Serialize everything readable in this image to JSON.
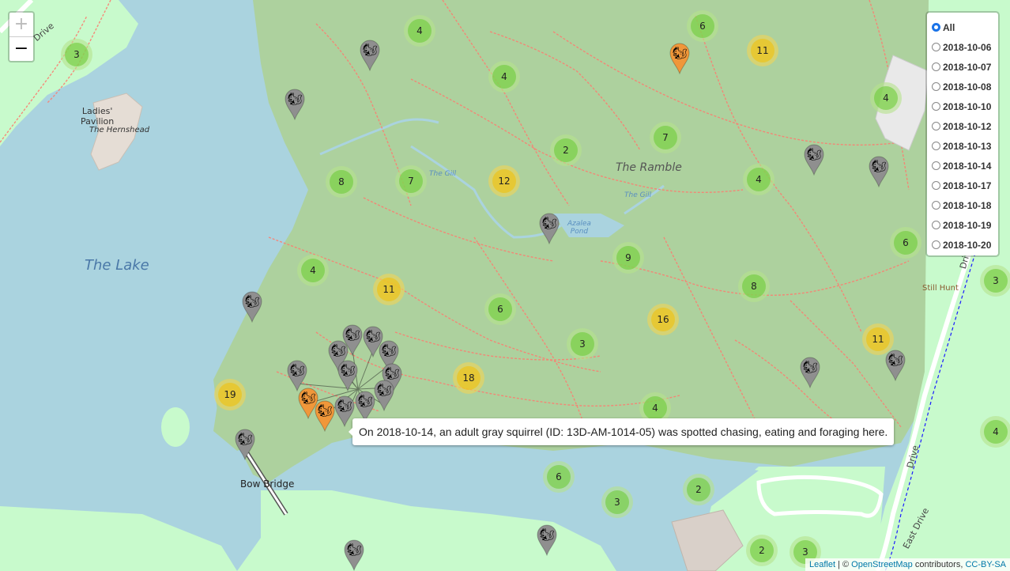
{
  "map": {
    "labels": {
      "ramble": "The Ramble",
      "lake": "The Lake",
      "ladies_pavilion": "Ladies'\nPavilion",
      "hernshead": "The Hernshead",
      "gill1": "The Gill",
      "gill2": "The Gill",
      "azalea_pond": "Azalea\nPond",
      "still_hunt": "Still Hunt",
      "bow_bridge": "Bow Bridge",
      "east_drive1": "East Drive",
      "east_drive2": "Drive",
      "drive_tl": "Drive",
      "drive_r": "Drive"
    },
    "clusters": [
      {
        "count": "3",
        "size": "small"
      },
      {
        "count": "4",
        "size": "small"
      },
      {
        "count": "6",
        "size": "small"
      },
      {
        "count": "11",
        "size": "medium"
      },
      {
        "count": "4",
        "size": "small"
      },
      {
        "count": "4",
        "size": "small"
      },
      {
        "count": "2",
        "size": "small"
      },
      {
        "count": "7",
        "size": "small"
      },
      {
        "count": "8",
        "size": "small"
      },
      {
        "count": "7",
        "size": "small"
      },
      {
        "count": "12",
        "size": "medium"
      },
      {
        "count": "4",
        "size": "small"
      },
      {
        "count": "6",
        "size": "small"
      },
      {
        "count": "9",
        "size": "small"
      },
      {
        "count": "8",
        "size": "small"
      },
      {
        "count": "4",
        "size": "small"
      },
      {
        "count": "11",
        "size": "medium"
      },
      {
        "count": "6",
        "size": "small"
      },
      {
        "count": "16",
        "size": "medium"
      },
      {
        "count": "3",
        "size": "small"
      },
      {
        "count": "11",
        "size": "medium"
      },
      {
        "count": "19",
        "size": "medium"
      },
      {
        "count": "18",
        "size": "medium"
      },
      {
        "count": "4",
        "size": "small"
      },
      {
        "count": "6",
        "size": "small"
      },
      {
        "count": "3",
        "size": "small"
      },
      {
        "count": "2",
        "size": "small"
      },
      {
        "count": "2",
        "size": "small"
      },
      {
        "count": "3",
        "size": "small"
      },
      {
        "count": "3",
        "size": "small"
      },
      {
        "count": "4",
        "size": "small"
      }
    ],
    "markers": {
      "gray_color": "#8f8f8f",
      "orange_color": "#f0973a",
      "icon": "squirrel-icon"
    }
  },
  "controls": {
    "zoom_in": "+",
    "zoom_out": "−",
    "layers": [
      "All",
      "2018-10-06",
      "2018-10-07",
      "2018-10-08",
      "2018-10-10",
      "2018-10-12",
      "2018-10-13",
      "2018-10-14",
      "2018-10-17",
      "2018-10-18",
      "2018-10-19",
      "2018-10-20"
    ],
    "selected_layer": "All"
  },
  "tooltip": {
    "text": "On 2018-10-14, an adult gray squirrel (ID: 13D-AM-1014-05) was spotted chasing, eating and foraging here."
  },
  "attribution": {
    "leaflet": "Leaflet",
    "sep": " | © ",
    "osm": "OpenStreetMap",
    "contrib": " contributors, ",
    "license": "CC-BY-SA"
  },
  "colors": {
    "water": "#aad3df",
    "park": "#c8facc",
    "wood": "#add19e",
    "path": "#fa8072"
  }
}
